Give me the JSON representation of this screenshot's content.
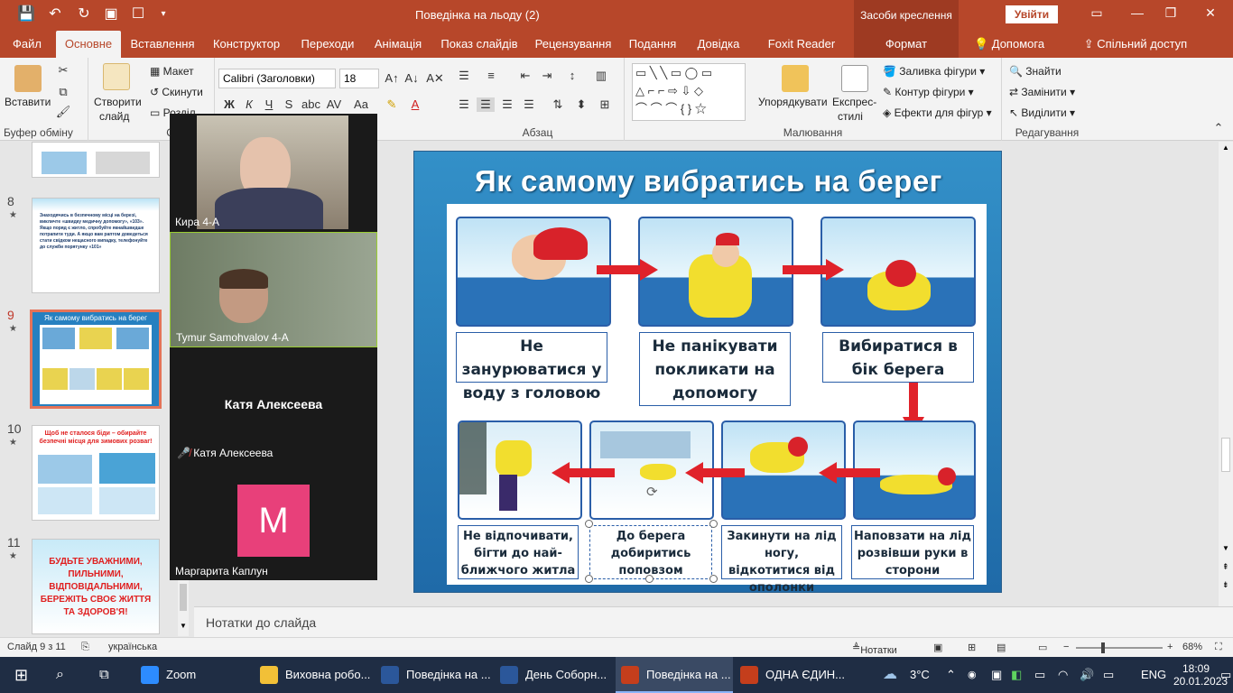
{
  "window": {
    "title": "Поведінка на льоду (2)",
    "context_title": "Засоби креслення",
    "signin": "Увійти"
  },
  "tabs": [
    "Файл",
    "Основне",
    "Вставлення",
    "Конструктор",
    "Переходи",
    "Анімація",
    "Показ слайдів",
    "Рецензування",
    "Подання",
    "Довідка",
    "Foxit Reader PDF",
    "Формат"
  ],
  "tab_help": "Допомога",
  "tab_share": "Спільний доступ",
  "ribbon": {
    "paste": "Вставити",
    "clipboard_group": "Буфер обміну",
    "new_slide": "Створити",
    "new_slide2": "слайд",
    "layout": "Макет",
    "reset": "Скинути",
    "section": "Розділ",
    "slides_group": "Слайди",
    "font_name": "Calibri (Заголовки)",
    "font_size": "18",
    "paragraph_group": "Абзац",
    "arrange": "Упорядкувати",
    "quick_styles": "Експрес-",
    "quick_styles2": "стилі",
    "shape_fill": "Заливка фігури",
    "shape_outline": "Контур фігури",
    "shape_effects": "Ефекти для фігур",
    "drawing_group": "Малювання",
    "find": "Знайти",
    "replace": "Замінити",
    "select": "Виділити",
    "editing_group": "Редагування"
  },
  "thumbs": [
    {
      "num": "8",
      "text": "Знаходячись в безпечному місці на березі, викличте «швидку медичну допомогу», «103». Якщо поряд є житло, спробуйте якнайшвидше потрапити туди. А якщо вам раптом доведеться стати свідком нещасного випадку, телефонуйте до служби порятунку «101»"
    },
    {
      "num": "9",
      "text": "Як самому вибратись на берег"
    },
    {
      "num": "10",
      "text": "Щоб не сталося біди – обирайте безпечні місця для зимових розваг!"
    },
    {
      "num": "11",
      "text": "БУДЬТЕ УВАЖНИМИ, ПИЛЬНИМИ, ВІДПОВІДАЛЬНИМИ, БЕРЕЖІТЬ СВОЄ ЖИТТЯ ТА ЗДОРОВ'Я!"
    }
  ],
  "slide": {
    "title": "Як самому вибратись на берег",
    "captions": [
      "Не занурюватися у воду з головою",
      "Не панікувати покликати на допомогу",
      "Вибиратися в бік берега",
      "Не відпочивати, бігти до най-ближчого житла",
      "До берега добиритись поповзом",
      "Закинути на лід ногу, відкотитися від ополонки",
      "Наповзати на лід розвівши руки в сторони"
    ]
  },
  "zoom": {
    "participants": [
      {
        "name": "Кира 4-А"
      },
      {
        "name": "Tymur Samohvalov 4-A"
      },
      {
        "name": "Катя Алексеева",
        "muted_label": "Катя Алексеева"
      },
      {
        "name": "Маргарита Каплун",
        "initial": "M"
      }
    ]
  },
  "notes_placeholder": "Нотатки до слайда",
  "status": {
    "slide": "Слайд 9 з 11",
    "language": "українська",
    "notes": "Нотатки",
    "zoom": "68%"
  },
  "taskbar": {
    "items": [
      "Zoom",
      "Виховна робо...",
      "Поведінка на ...",
      "День Соборн...",
      "Поведінка на ...",
      "ОДНА ЄДИН..."
    ],
    "weather": "3°C",
    "lang": "ENG",
    "time": "18:09",
    "date": "20.01.2023"
  },
  "colors": {
    "accent": "#b7472a",
    "slide_bg": "#2680c0",
    "arrow": "#e0222a",
    "zoom_avatar": "#e8407a"
  }
}
